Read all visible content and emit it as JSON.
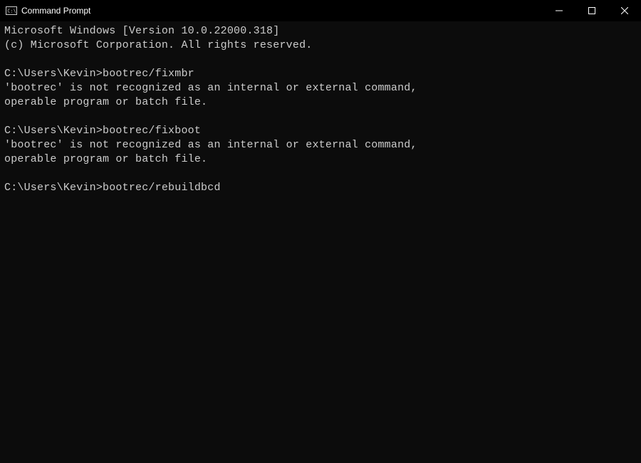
{
  "window": {
    "title": "Command Prompt"
  },
  "terminal": {
    "lines": [
      "Microsoft Windows [Version 10.0.22000.318]",
      "(c) Microsoft Corporation. All rights reserved.",
      "",
      "C:\\Users\\Kevin>bootrec/fixmbr",
      "'bootrec' is not recognized as an internal or external command,",
      "operable program or batch file.",
      "",
      "C:\\Users\\Kevin>bootrec/fixboot",
      "'bootrec' is not recognized as an internal or external command,",
      "operable program or batch file.",
      "",
      "C:\\Users\\Kevin>bootrec/rebuildbcd",
      ""
    ]
  }
}
